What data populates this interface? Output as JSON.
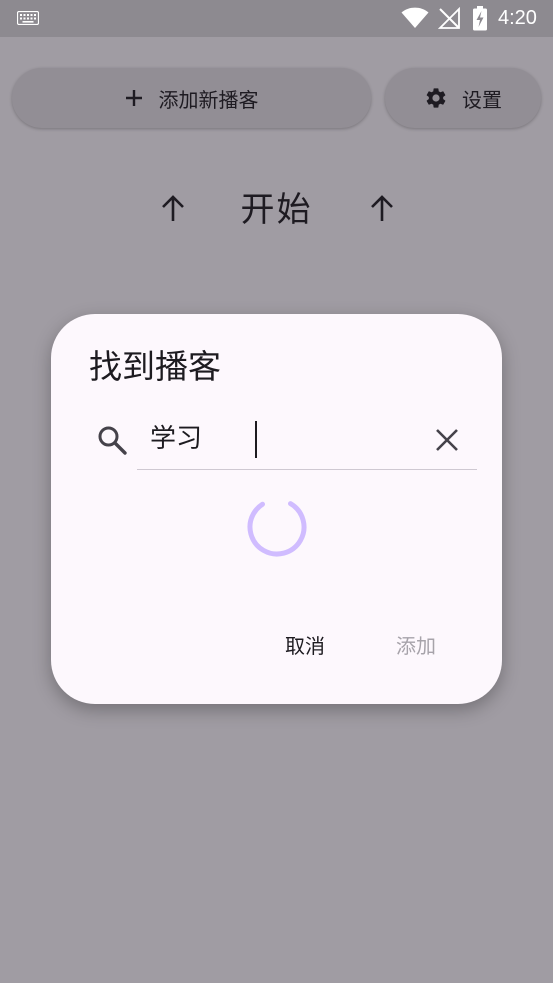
{
  "status_bar": {
    "time": "4:20",
    "icons": [
      "keyboard-icon",
      "wifi-icon",
      "no-signal-icon",
      "battery-charging-icon"
    ]
  },
  "toolbar": {
    "add_podcast_label": "添加新播客",
    "settings_label": "设置"
  },
  "main": {
    "start_label": "开始"
  },
  "dialog": {
    "title": "找到播客",
    "search": {
      "value": "学习"
    },
    "cancel_label": "取消",
    "add_label": "添加"
  },
  "colors": {
    "scrim_background": "#a09ca3",
    "dialog_surface": "#fdf8fd",
    "spinner": "#d0bcff",
    "disabled_text": "#a7a3aa"
  }
}
